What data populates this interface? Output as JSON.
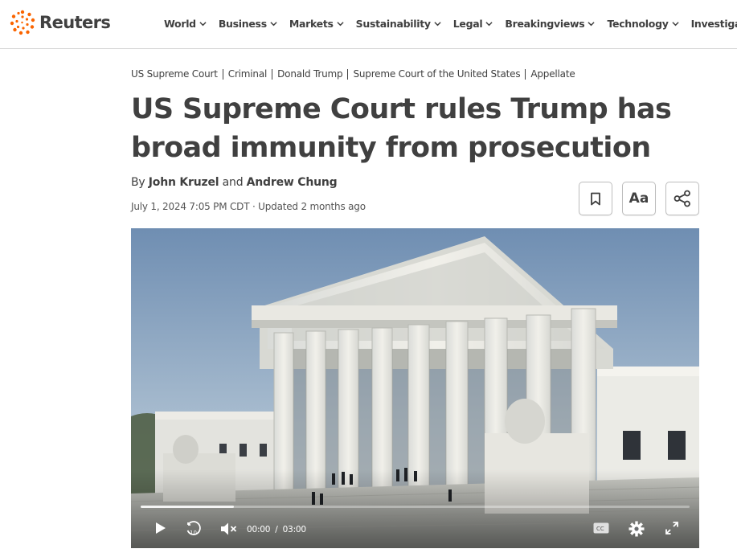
{
  "brand": {
    "name": "Reuters",
    "accent": "#FA6400"
  },
  "nav": {
    "items": [
      {
        "label": "World"
      },
      {
        "label": "Business"
      },
      {
        "label": "Markets"
      },
      {
        "label": "Sustainability"
      },
      {
        "label": "Legal"
      },
      {
        "label": "Breakingviews"
      },
      {
        "label": "Technology"
      },
      {
        "label": "Investigations"
      }
    ]
  },
  "article": {
    "breadcrumbs": [
      "US Supreme Court",
      "Criminal",
      "Donald Trump",
      "Supreme Court of the United States",
      "Appellate"
    ],
    "headline": "US Supreme Court rules Trump has broad immunity from prosecution",
    "byline": {
      "prefix": "By",
      "authors": [
        "John Kruzel",
        "Andrew Chung"
      ],
      "conjunction": "and"
    },
    "dateline": "July 1, 2024 7:05 PM CDT · Updated 2 months ago",
    "tools": {
      "bookmark_icon": "bookmark-icon",
      "text_size_label": "Aa",
      "share_icon": "share-icon"
    }
  },
  "video": {
    "current_time": "00:00",
    "duration": "03:00",
    "progress": 0.17,
    "icons": [
      "play-icon",
      "replay-10-icon",
      "mute-icon",
      "closed-captions-icon",
      "settings-icon",
      "fullscreen-icon"
    ]
  }
}
